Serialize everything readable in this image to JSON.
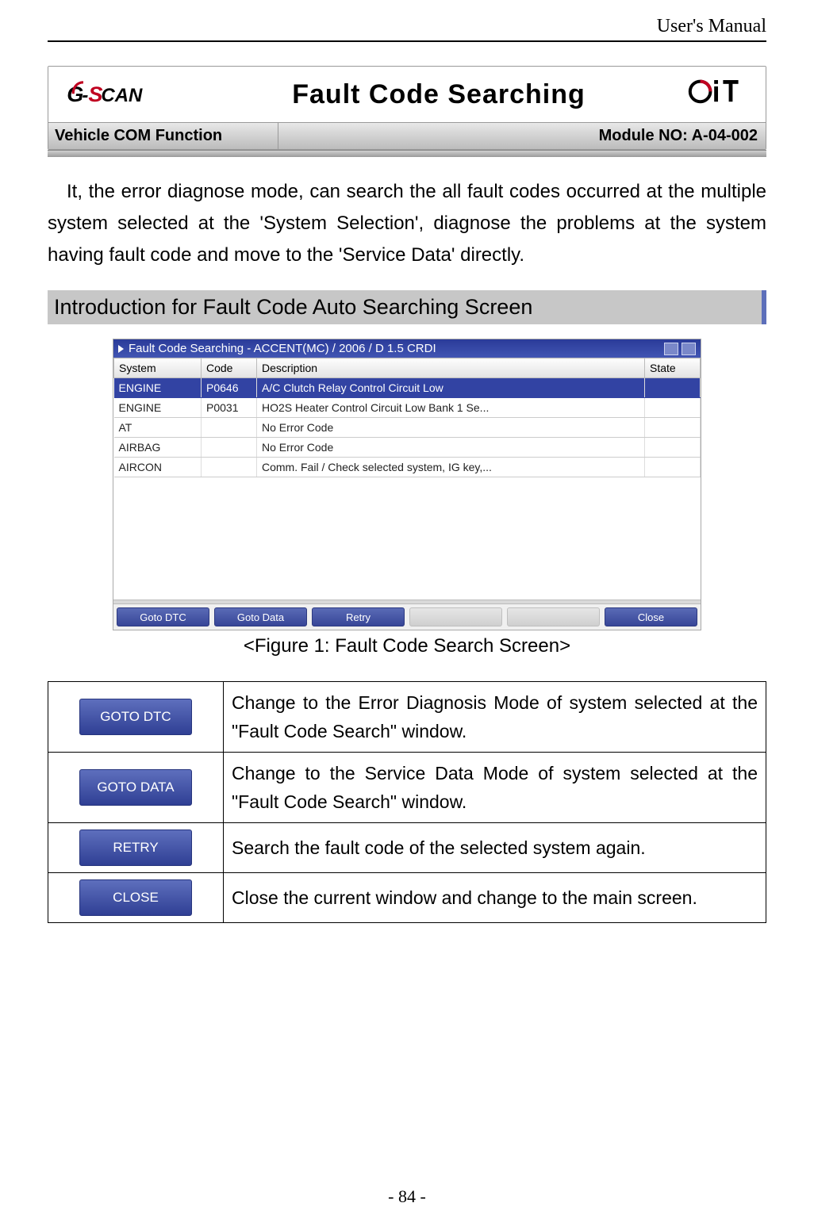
{
  "header": {
    "text": "User's Manual"
  },
  "banner": {
    "title": "Fault Code Searching",
    "left_label": "Vehicle COM Function",
    "right_label": "Module NO: A-04-002"
  },
  "intro_paragraph": "It, the error diagnose mode, can search the all fault codes occurred at the multiple system selected at the 'System Selection', diagnose the problems at the system having fault code and move to the 'Service Data' directly.",
  "section_header": "Introduction for Fault Code Auto Searching Screen",
  "screenshot": {
    "window_title": "Fault Code Searching - ACCENT(MC) / 2006 / D 1.5 CRDI",
    "columns": {
      "c1": "System",
      "c2": "Code",
      "c3": "Description",
      "c4": "State"
    },
    "rows": [
      {
        "system": "ENGINE",
        "code": "P0646",
        "desc": "A/C Clutch Relay Control Circuit Low",
        "state": "",
        "selected": true
      },
      {
        "system": "ENGINE",
        "code": "P0031",
        "desc": "HO2S Heater Control Circuit Low Bank 1  Se...",
        "state": "",
        "selected": false
      },
      {
        "system": "AT",
        "code": "",
        "desc": "No Error Code",
        "state": "",
        "selected": false
      },
      {
        "system": "AIRBAG",
        "code": "",
        "desc": "No Error Code",
        "state": "",
        "selected": false
      },
      {
        "system": "AIRCON",
        "code": "",
        "desc": "Comm. Fail / Check selected system, IG key,...",
        "state": "",
        "selected": false
      }
    ],
    "buttons": {
      "goto_dtc": "Goto DTC",
      "goto_data": "Goto Data",
      "retry": "Retry",
      "close": "Close"
    }
  },
  "figure_caption": "<Figure 1: Fault Code Search Screen>",
  "desc_table": [
    {
      "button": "GOTO DTC",
      "text": "Change to the Error Diagnosis Mode of system selected at the \"Fault Code Search\" window."
    },
    {
      "button": "GOTO DATA",
      "text": "Change to the Service Data Mode of system selected at the \"Fault Code Search\" window."
    },
    {
      "button": "RETRY",
      "text": "Search the fault code of the selected system again."
    },
    {
      "button": "CLOSE",
      "text": "Close the current window and change to the main screen."
    }
  ],
  "page_number": "- 84 -"
}
